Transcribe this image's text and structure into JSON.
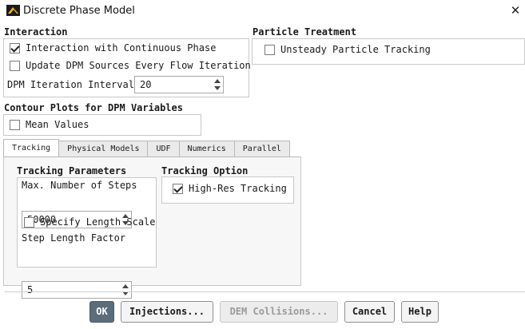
{
  "window": {
    "title": "Discrete Phase Model",
    "close_symbol": "✕"
  },
  "interaction": {
    "title": "Interaction",
    "interaction_continuous": {
      "label": "Interaction with Continuous Phase",
      "checked": true
    },
    "update_dpm_sources": {
      "label": "Update DPM Sources Every Flow Iteration",
      "checked": false
    },
    "dpm_iteration_interval": {
      "label": "DPM Iteration Interval",
      "value": "20"
    }
  },
  "particle_treatment": {
    "title": "Particle Treatment",
    "unsteady_tracking": {
      "label": "Unsteady Particle Tracking",
      "checked": false
    }
  },
  "contour_plots": {
    "title": "Contour Plots for DPM Variables",
    "mean_values": {
      "label": "Mean Values",
      "checked": false
    }
  },
  "tabs": [
    {
      "label": "Tracking",
      "active": true
    },
    {
      "label": "Physical Models",
      "active": false
    },
    {
      "label": "UDF",
      "active": false
    },
    {
      "label": "Numerics",
      "active": false
    },
    {
      "label": "Parallel",
      "active": false
    }
  ],
  "tracking_parameters": {
    "title": "Tracking Parameters",
    "max_steps": {
      "label": "Max. Number of Steps",
      "value": "50000"
    },
    "specify_length_scale": {
      "label": "Specify Length Scale",
      "checked": false
    },
    "step_length_factor": {
      "label": "Step Length Factor",
      "value": "5"
    }
  },
  "tracking_option": {
    "title": "Tracking Option",
    "high_res": {
      "label": "High-Res Tracking",
      "checked": true
    }
  },
  "buttons": {
    "ok": "OK",
    "injections": "Injections...",
    "dem_collisions": "DEM Collisions...",
    "cancel": "Cancel",
    "help": "Help"
  }
}
